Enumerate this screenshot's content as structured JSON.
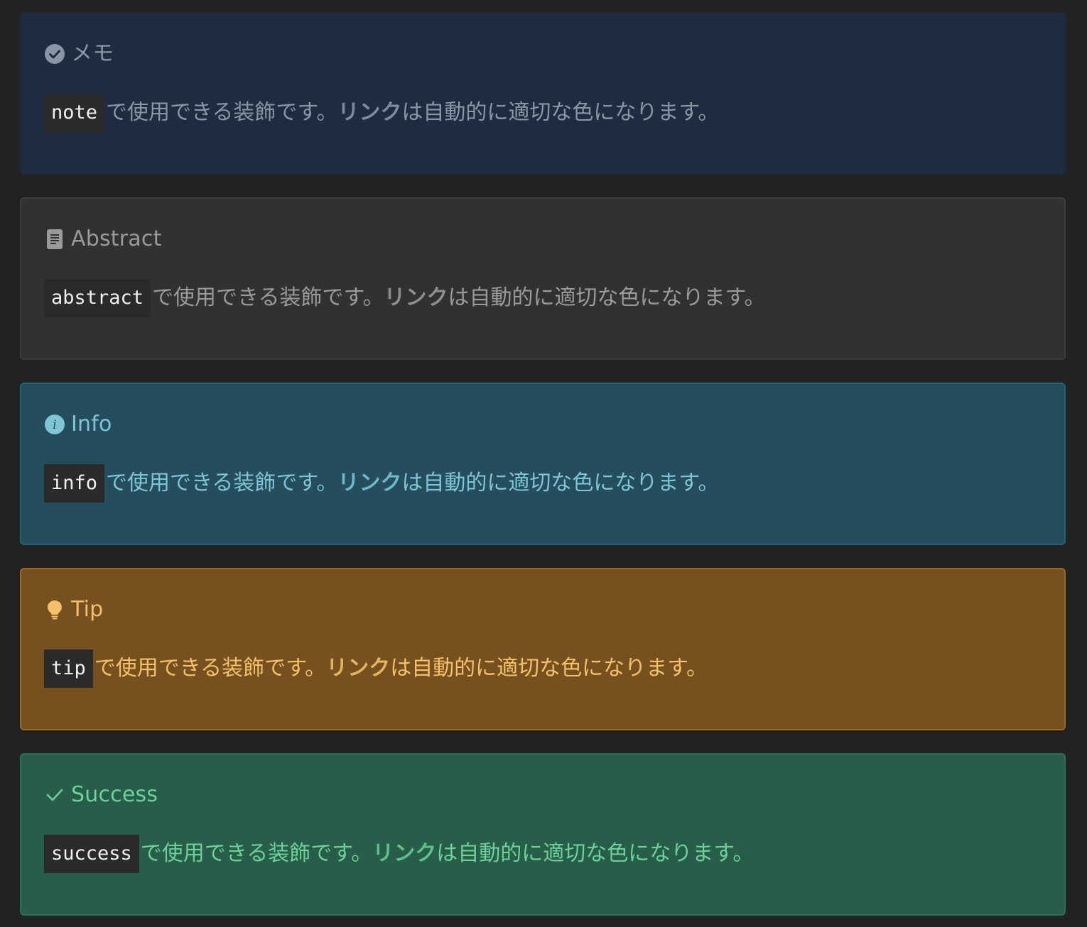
{
  "colors": {
    "page_background": "#222222",
    "note_background": "#1f2b3e",
    "abstract_background": "#313131",
    "info_background": "#244e5d",
    "tip_background": "#77501f",
    "success_background": "#265e4a"
  },
  "callouts": [
    {
      "icon": "check-circle-icon",
      "title": "メモ",
      "code": "note",
      "text_before": "で使用できる装飾です。",
      "link": "リンク",
      "text_after": "は自動的に適切な色になります。"
    },
    {
      "icon": "document-icon",
      "title": "Abstract",
      "code": "abstract",
      "text_before": "で使用できる装飾です。",
      "link": "リンク",
      "text_after": "は自動的に適切な色になります。"
    },
    {
      "icon": "info-circle-icon",
      "title": "Info",
      "code": "info",
      "text_before": "で使用できる装飾です。",
      "link": "リンク",
      "text_after": "は自動的に適切な色になります。"
    },
    {
      "icon": "lightbulb-icon",
      "title": "Tip",
      "code": "tip",
      "text_before": "で使用できる装飾です。",
      "link": "リンク",
      "text_after": "は自動的に適切な色になります。"
    },
    {
      "icon": "checkmark-icon",
      "title": "Success",
      "code": "success",
      "text_before": "で使用できる装飾です。",
      "link": "リンク",
      "text_after": "は自動的に適切な色になります。"
    }
  ]
}
